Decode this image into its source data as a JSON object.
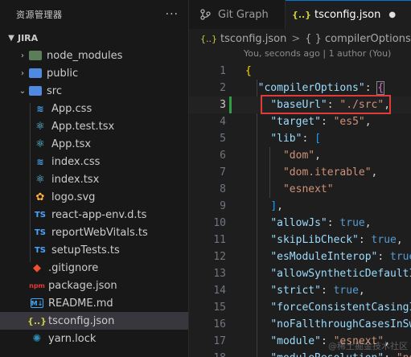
{
  "sidebar": {
    "title": "资源管理器",
    "more": "···",
    "section": "JIRA",
    "items": [
      {
        "label": "node_modules",
        "icon": "folder-node-modules-icon"
      },
      {
        "label": "public",
        "icon": "folder-public-icon"
      },
      {
        "label": "src",
        "icon": "folder-src-icon"
      },
      {
        "label": "App.css",
        "icon": "css-icon"
      },
      {
        "label": "App.test.tsx",
        "icon": "react-icon"
      },
      {
        "label": "App.tsx",
        "icon": "react-icon"
      },
      {
        "label": "index.css",
        "icon": "css-icon"
      },
      {
        "label": "index.tsx",
        "icon": "react-icon"
      },
      {
        "label": "logo.svg",
        "icon": "svg-icon"
      },
      {
        "label": "react-app-env.d.ts",
        "icon": "typescript-icon",
        "glyph": "TS"
      },
      {
        "label": "reportWebVitals.ts",
        "icon": "typescript-icon",
        "glyph": "TS"
      },
      {
        "label": "setupTests.ts",
        "icon": "typescript-icon",
        "glyph": "TS"
      },
      {
        "label": ".gitignore",
        "icon": "git-icon"
      },
      {
        "label": "package.json",
        "icon": "npm-icon",
        "glyph": "npm"
      },
      {
        "label": "README.md",
        "icon": "markdown-icon",
        "glyph": "M↓"
      },
      {
        "label": "tsconfig.json",
        "icon": "json-icon",
        "glyph": "{..}"
      },
      {
        "label": "yarn.lock",
        "icon": "yarn-icon"
      }
    ]
  },
  "tabs": [
    {
      "label": "Git Graph",
      "icon": "git-graph-icon"
    },
    {
      "label": "tsconfig.json",
      "icon": "json-icon",
      "glyph": "{..}",
      "dirty": "●"
    }
  ],
  "breadcrumb": {
    "file": "tsconfig.json",
    "file_glyph": "{..}",
    "separator": ">",
    "symbol_glyph": "{ }",
    "symbol": "compilerOptions"
  },
  "codelens": "You, seconds ago | 1 author (You)",
  "code": {
    "line_numbers": [
      "1",
      "2",
      "3",
      "4",
      "5",
      "6",
      "7",
      "8",
      "9",
      "10",
      "11",
      "12",
      "13",
      "14",
      "15",
      "16",
      "17",
      "18"
    ],
    "current_line": "3",
    "lines": [
      [
        {
          "t": "{",
          "c": "br1"
        }
      ],
      [
        {
          "t": "  "
        },
        {
          "t": "\"compilerOptions\"",
          "c": "k"
        },
        {
          "t": ": ",
          "c": "p"
        },
        {
          "t": "{",
          "c": "br2"
        }
      ],
      [
        {
          "t": "    "
        },
        {
          "t": "\"baseUrl\"",
          "c": "k"
        },
        {
          "t": ": ",
          "c": "p"
        },
        {
          "t": "\"./src\"",
          "c": "s"
        },
        {
          "t": ",",
          "c": "p"
        }
      ],
      [
        {
          "t": "    "
        },
        {
          "t": "\"target\"",
          "c": "k"
        },
        {
          "t": ": ",
          "c": "p"
        },
        {
          "t": "\"es5\"",
          "c": "s"
        },
        {
          "t": ",",
          "c": "p"
        }
      ],
      [
        {
          "t": "    "
        },
        {
          "t": "\"lib\"",
          "c": "k"
        },
        {
          "t": ": ",
          "c": "p"
        },
        {
          "t": "[",
          "c": "br3"
        }
      ],
      [
        {
          "t": "      "
        },
        {
          "t": "\"dom\"",
          "c": "s"
        },
        {
          "t": ",",
          "c": "p"
        }
      ],
      [
        {
          "t": "      "
        },
        {
          "t": "\"dom.iterable\"",
          "c": "s"
        },
        {
          "t": ",",
          "c": "p"
        }
      ],
      [
        {
          "t": "      "
        },
        {
          "t": "\"esnext\"",
          "c": "s"
        }
      ],
      [
        {
          "t": "    "
        },
        {
          "t": "]",
          "c": "br3"
        },
        {
          "t": ",",
          "c": "p"
        }
      ],
      [
        {
          "t": "    "
        },
        {
          "t": "\"allowJs\"",
          "c": "k"
        },
        {
          "t": ": ",
          "c": "p"
        },
        {
          "t": "true",
          "c": "b"
        },
        {
          "t": ",",
          "c": "p"
        }
      ],
      [
        {
          "t": "    "
        },
        {
          "t": "\"skipLibCheck\"",
          "c": "k"
        },
        {
          "t": ": ",
          "c": "p"
        },
        {
          "t": "true",
          "c": "b"
        },
        {
          "t": ",",
          "c": "p"
        }
      ],
      [
        {
          "t": "    "
        },
        {
          "t": "\"esModuleInterop\"",
          "c": "k"
        },
        {
          "t": ": ",
          "c": "p"
        },
        {
          "t": "true",
          "c": "b"
        }
      ],
      [
        {
          "t": "    "
        },
        {
          "t": "\"allowSyntheticDefaultI",
          "c": "k"
        }
      ],
      [
        {
          "t": "    "
        },
        {
          "t": "\"strict\"",
          "c": "k"
        },
        {
          "t": ": ",
          "c": "p"
        },
        {
          "t": "true",
          "c": "b"
        },
        {
          "t": ",",
          "c": "p"
        }
      ],
      [
        {
          "t": "    "
        },
        {
          "t": "\"forceConsistentCasingI",
          "c": "k"
        }
      ],
      [
        {
          "t": "    "
        },
        {
          "t": "\"noFallthroughCasesInSw",
          "c": "k"
        }
      ],
      [
        {
          "t": "    "
        },
        {
          "t": "\"module\"",
          "c": "k"
        },
        {
          "t": ": ",
          "c": "p"
        },
        {
          "t": "\"esnext\"",
          "c": "s"
        },
        {
          "t": ",",
          "c": "p"
        }
      ],
      [
        {
          "t": "    "
        },
        {
          "t": "\"moduleResolution\"",
          "c": "k"
        },
        {
          "t": ": ",
          "c": "p"
        },
        {
          "t": "\"no",
          "c": "s"
        }
      ]
    ]
  },
  "watermark": "@稀土掘金技术社区",
  "colors": {
    "accent": "#0078d4",
    "highlight_box": "#e03a3a",
    "modified_bar": "#2ea043"
  }
}
